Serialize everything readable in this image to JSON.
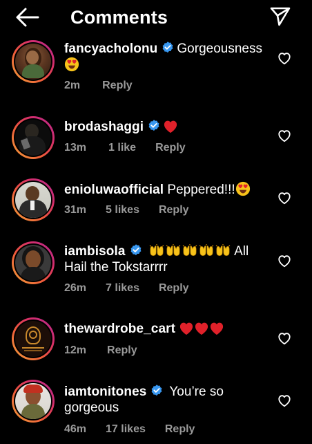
{
  "header": {
    "title": "Comments"
  },
  "comments": [
    {
      "username": "fancyacholonu",
      "verified": true,
      "text": "Gorgeousness",
      "time": "2m",
      "likes": "",
      "reply": "Reply"
    },
    {
      "username": "brodashaggi",
      "verified": true,
      "text": "",
      "time": "13m",
      "likes": "1 like",
      "reply": "Reply"
    },
    {
      "username": "enioluwaofficial",
      "verified": false,
      "text": "Peppered!!!",
      "time": "31m",
      "likes": "5 likes",
      "reply": "Reply"
    },
    {
      "username": "iambisola",
      "verified": true,
      "text": "All",
      "text_line2": "Hail the Tokstarrrr",
      "time": "26m",
      "likes": "7 likes",
      "reply": "Reply"
    },
    {
      "username": "thewardrobe_cart",
      "verified": false,
      "text": "",
      "time": "12m",
      "likes": "",
      "reply": "Reply"
    },
    {
      "username": "iamtonitones",
      "verified": true,
      "text": "You’re so",
      "text_line2": "gorgeous",
      "time": "46m",
      "likes": "17 likes",
      "reply": "Reply"
    }
  ],
  "colors": {
    "verified": "#3897f0",
    "heart_red": "#e0212a",
    "meta_grey": "#9a9a9a",
    "emoji_yellow": "#f7c21a"
  },
  "icons": [
    "back-arrow-icon",
    "send-icon",
    "verified-icon",
    "heart-outline-icon",
    "heart-eyes-emoji",
    "red-heart-emoji",
    "raising-hands-emoji"
  ]
}
